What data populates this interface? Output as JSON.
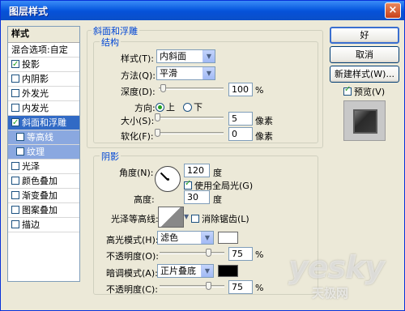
{
  "window": {
    "title": "图层样式",
    "close": "×"
  },
  "sidebar": {
    "header": "样式",
    "items": [
      {
        "label": "混合选项:自定",
        "checkbox": false,
        "checked": false,
        "selected": false,
        "sub": false
      },
      {
        "label": "投影",
        "checkbox": true,
        "checked": true,
        "selected": false,
        "sub": false
      },
      {
        "label": "内阴影",
        "checkbox": true,
        "checked": false,
        "selected": false,
        "sub": false
      },
      {
        "label": "外发光",
        "checkbox": true,
        "checked": false,
        "selected": false,
        "sub": false
      },
      {
        "label": "内发光",
        "checkbox": true,
        "checked": false,
        "selected": false,
        "sub": false
      },
      {
        "label": "斜面和浮雕",
        "checkbox": true,
        "checked": true,
        "selected": true,
        "sub": false
      },
      {
        "label": "等高线",
        "checkbox": true,
        "checked": false,
        "selected": false,
        "sub": true
      },
      {
        "label": "纹理",
        "checkbox": true,
        "checked": false,
        "selected": false,
        "sub": true
      },
      {
        "label": "光泽",
        "checkbox": true,
        "checked": false,
        "selected": false,
        "sub": false
      },
      {
        "label": "颜色叠加",
        "checkbox": true,
        "checked": false,
        "selected": false,
        "sub": false
      },
      {
        "label": "渐变叠加",
        "checkbox": true,
        "checked": false,
        "selected": false,
        "sub": false
      },
      {
        "label": "图案叠加",
        "checkbox": true,
        "checked": false,
        "selected": false,
        "sub": false
      },
      {
        "label": "描边",
        "checkbox": true,
        "checked": false,
        "selected": false,
        "sub": false
      }
    ]
  },
  "bevel": {
    "group_title": "斜面和浮雕",
    "structure_title": "结构",
    "style_label": "样式(T):",
    "style_value": "内斜面",
    "technique_label": "方法(Q):",
    "technique_value": "平滑",
    "depth_label": "深度(D):",
    "depth_value": "100",
    "depth_unit": "%",
    "direction_label": "方向:",
    "direction_up": "上",
    "direction_down": "下",
    "size_label": "大小(S):",
    "size_value": "5",
    "size_unit": "像素",
    "soften_label": "软化(F):",
    "soften_value": "0",
    "soften_unit": "像素"
  },
  "shading": {
    "title": "阴影",
    "angle_label": "角度(N):",
    "angle_value": "120",
    "angle_unit": "度",
    "global_light_label": "使用全局光(G)",
    "altitude_label": "高度:",
    "altitude_value": "30",
    "altitude_unit": "度",
    "gloss_label": "光泽等高线:",
    "antialias_label": "消除锯齿(L)",
    "highlight_label": "高光模式(H):",
    "highlight_value": "滤色",
    "highlight_color": "#ffffff",
    "highlight_opacity_label": "不透明度(O):",
    "highlight_opacity_value": "75",
    "highlight_opacity_unit": "%",
    "shadow_label": "暗调模式(A):",
    "shadow_value": "正片叠底",
    "shadow_color": "#000000",
    "shadow_opacity_label": "不透明度(C):",
    "shadow_opacity_value": "75",
    "shadow_opacity_unit": "%"
  },
  "buttons": {
    "ok": "好",
    "cancel": "取消",
    "new_style": "新建样式(W)...",
    "preview_label": "预览(V)"
  },
  "watermark": {
    "brand": "yesky",
    "sub": "天极网"
  }
}
